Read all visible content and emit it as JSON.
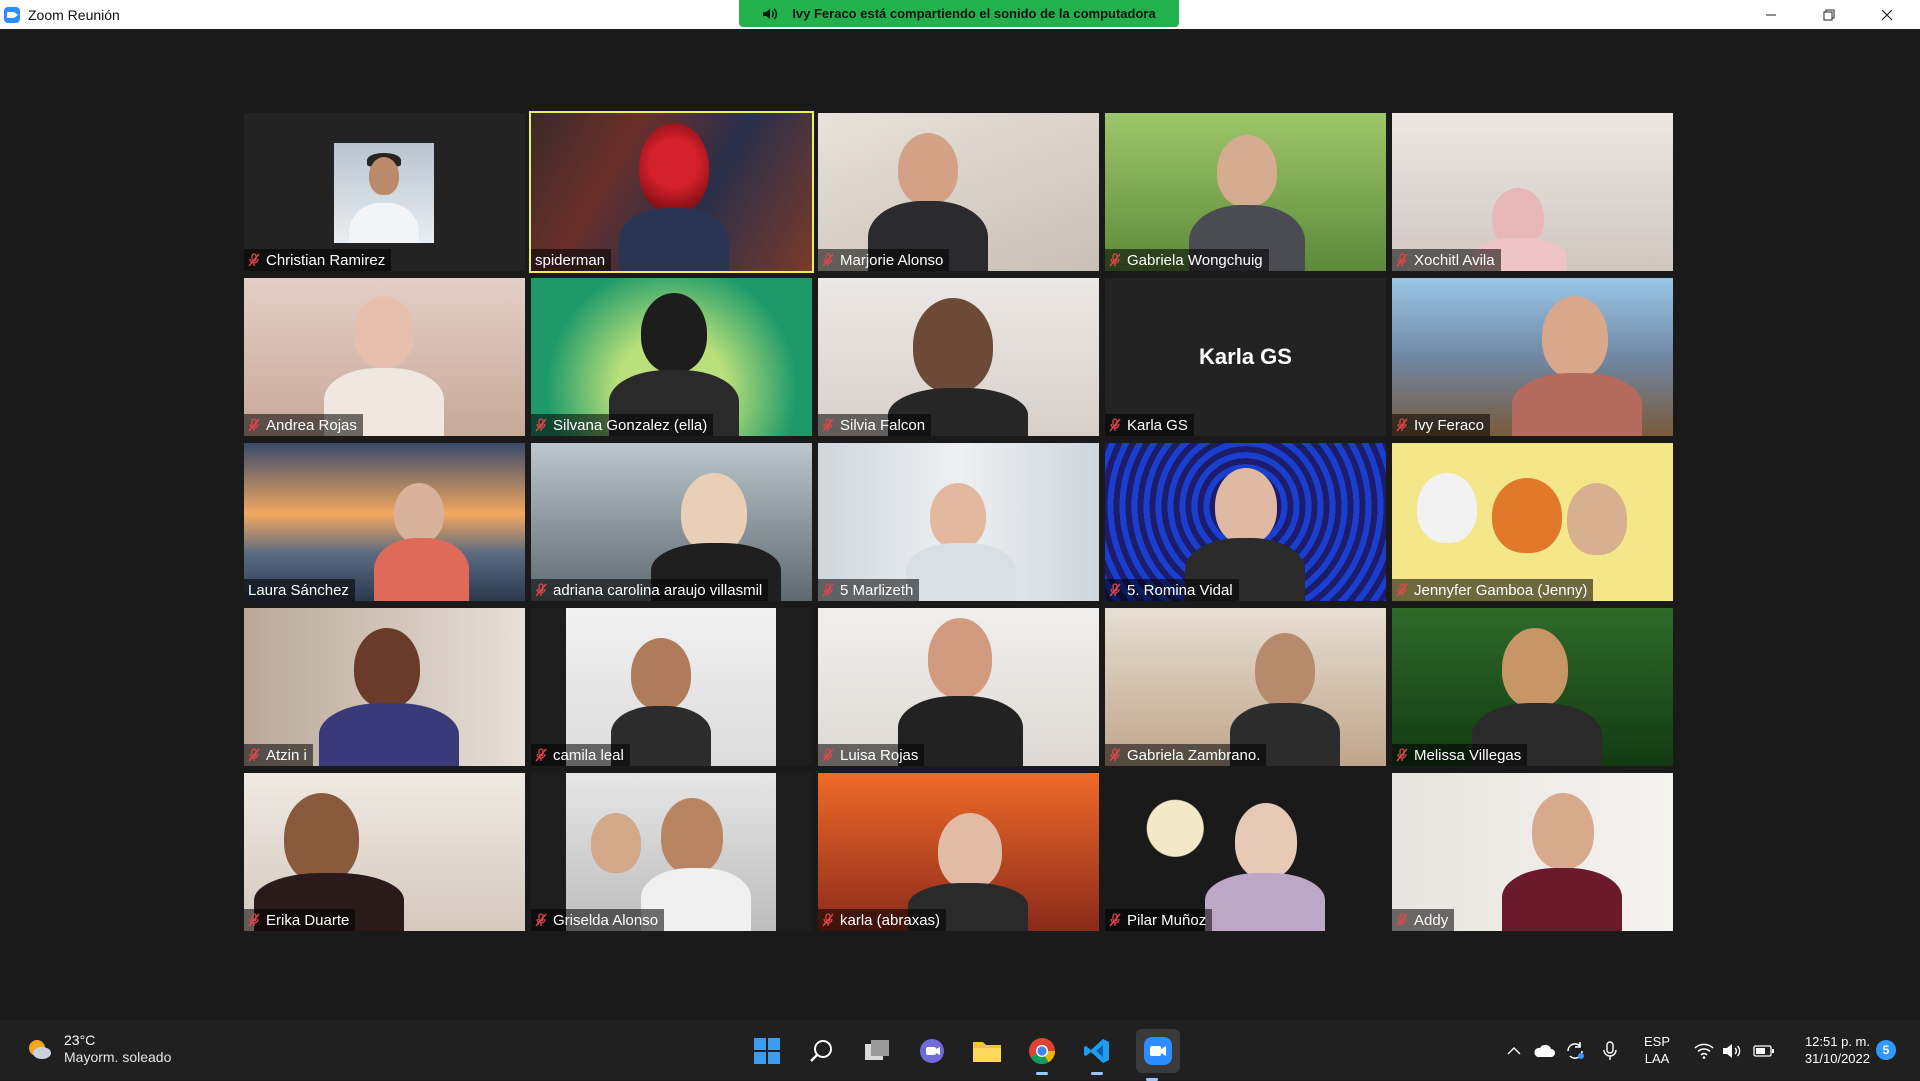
{
  "window": {
    "title": "Zoom Reunión",
    "share_banner": "Ivy Feraco está compartiendo el sonido de la computadora"
  },
  "participants": [
    {
      "name": "Christian Ramirez",
      "muted": true
    },
    {
      "name": "spiderman",
      "muted": false,
      "active_speaker": true
    },
    {
      "name": "Marjorie Alonso",
      "muted": true
    },
    {
      "name": "Gabriela Wongchuig",
      "muted": true
    },
    {
      "name": "Xochitl Avila",
      "muted": true
    },
    {
      "name": "Andrea Rojas",
      "muted": true
    },
    {
      "name": "Silvana Gonzalez (ella)",
      "muted": true
    },
    {
      "name": "Silvia Falcon",
      "muted": true
    },
    {
      "name": "Karla GS",
      "muted": true,
      "video_off": true
    },
    {
      "name": "Ivy Feraco",
      "muted": true
    },
    {
      "name": "Laura Sánchez",
      "muted": false
    },
    {
      "name": "adriana carolina araujo villasmil",
      "muted": true
    },
    {
      "name": "5 Marlizeth",
      "muted": true
    },
    {
      "name": "5. Romina Vidal",
      "muted": true
    },
    {
      "name": "Jennyfer Gamboa (Jenny)",
      "muted": true
    },
    {
      "name": "Atzin i",
      "muted": true
    },
    {
      "name": "camila leal",
      "muted": true
    },
    {
      "name": "Luisa Rojas",
      "muted": true
    },
    {
      "name": "Gabriela Zambrano.",
      "muted": true
    },
    {
      "name": "Melissa Villegas",
      "muted": true
    },
    {
      "name": "Erika Duarte",
      "muted": true
    },
    {
      "name": "Griselda Alonso",
      "muted": true
    },
    {
      "name": "karla (abraxas)",
      "muted": true
    },
    {
      "name": "Pilar Muñoz",
      "muted": true
    },
    {
      "name": "Addy",
      "muted": true
    }
  ],
  "taskbar": {
    "weather_temp": "23°C",
    "weather_condition": "Mayorm. soleado",
    "apps": [
      "start-icon",
      "search-icon",
      "task-view-icon",
      "chat-icon",
      "file-explorer-icon",
      "chrome-icon",
      "vscode-icon",
      "zoom-icon"
    ],
    "lang_1": "ESP",
    "lang_2": "LAA",
    "time": "12:51 p. m.",
    "date": "31/10/2022",
    "notification_count": "5"
  },
  "colors": {
    "accent_active_speaker": "#e6f15c",
    "share_banner": "#23b14d",
    "mute_icon": "#e0464a"
  }
}
